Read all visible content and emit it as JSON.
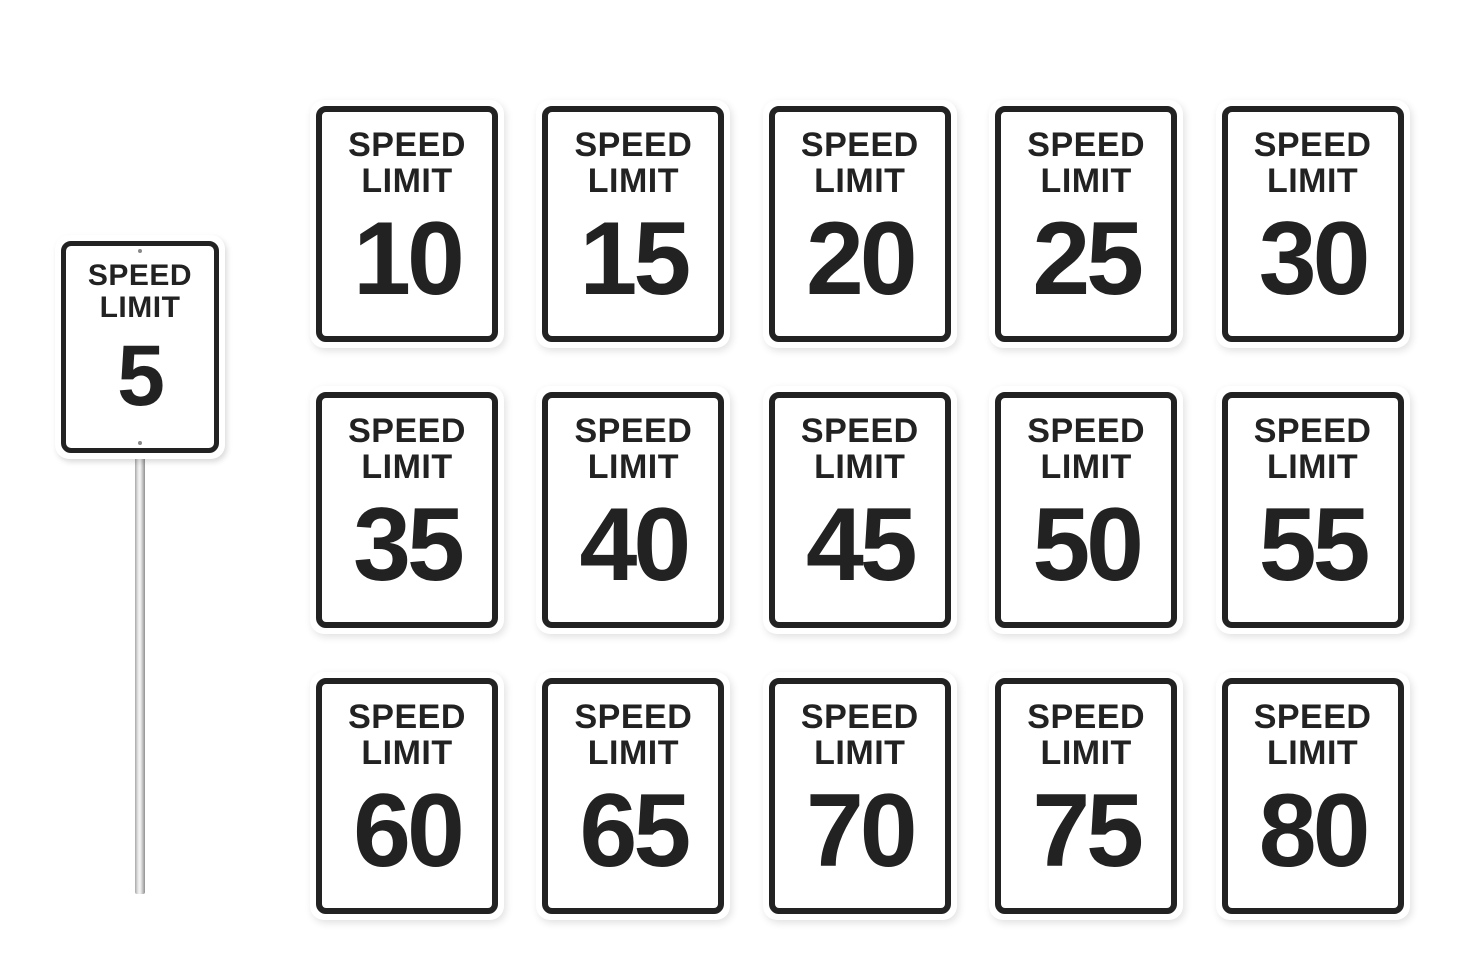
{
  "label_line1": "SPEED",
  "label_line2": "LIMIT",
  "featured_sign": {
    "value": "5"
  },
  "signs": [
    {
      "value": "10"
    },
    {
      "value": "15"
    },
    {
      "value": "20"
    },
    {
      "value": "25"
    },
    {
      "value": "30"
    },
    {
      "value": "35"
    },
    {
      "value": "40"
    },
    {
      "value": "45"
    },
    {
      "value": "50"
    },
    {
      "value": "55"
    },
    {
      "value": "60"
    },
    {
      "value": "65"
    },
    {
      "value": "70"
    },
    {
      "value": "75"
    },
    {
      "value": "80"
    }
  ]
}
